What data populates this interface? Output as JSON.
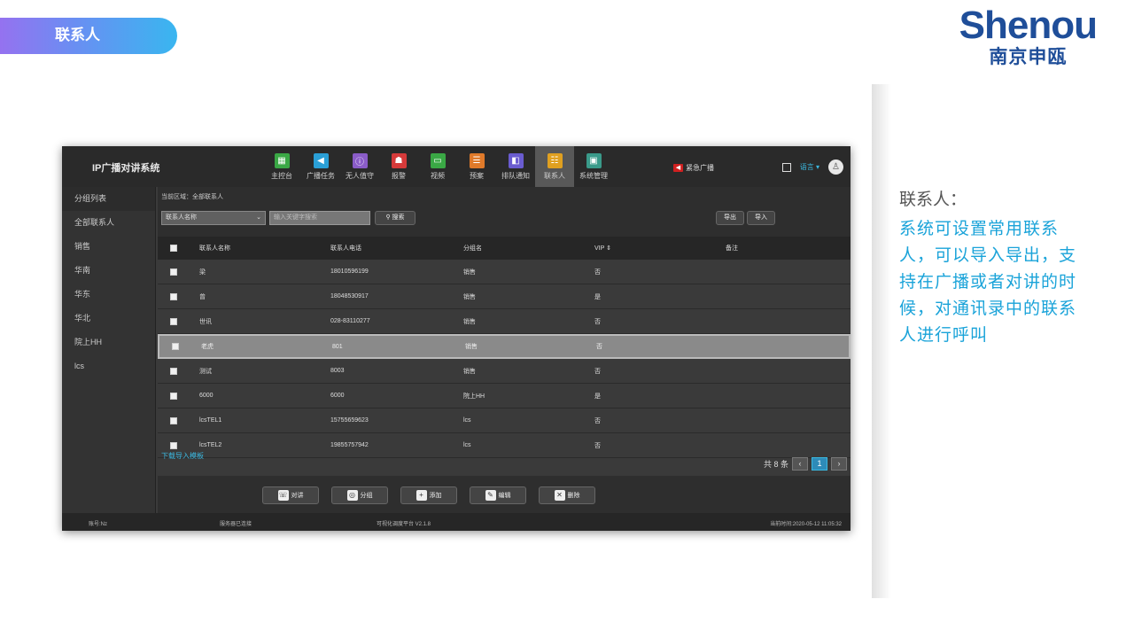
{
  "slide": {
    "tag_label": "联系人",
    "logo_en": "Shenou",
    "logo_cn": "南京申瓯",
    "desc_title": "联系人：",
    "desc_body": "系统可设置常用联系人，可以导入导出，支持在广播或者对讲的时候，对通讯录中的联系人进行呼叫"
  },
  "app": {
    "title": "IP广播对讲系统",
    "nav": [
      {
        "label": "主控台",
        "icon": "dashboard-icon",
        "color": "#3aa845",
        "glyph": "▦"
      },
      {
        "label": "广播任务",
        "icon": "broadcast-icon",
        "color": "#2a9fd6",
        "glyph": "◀"
      },
      {
        "label": "无人值守",
        "icon": "unattended-icon",
        "color": "#8a5cc7",
        "glyph": "ⓘ"
      },
      {
        "label": "报警",
        "icon": "alarm-icon",
        "color": "#d63a3a",
        "glyph": "☗"
      },
      {
        "label": "视频",
        "icon": "video-icon",
        "color": "#3aa845",
        "glyph": "▭"
      },
      {
        "label": "预案",
        "icon": "plan-icon",
        "color": "#e07a2a",
        "glyph": "☰"
      },
      {
        "label": "排队通知",
        "icon": "queue-icon",
        "color": "#6a5cd0",
        "glyph": "◧"
      },
      {
        "label": "联系人",
        "icon": "contacts-icon",
        "color": "#e0a020",
        "glyph": "☷"
      },
      {
        "label": "系统管理",
        "icon": "system-icon",
        "color": "#3a9a8a",
        "glyph": "▣"
      }
    ],
    "emergency_label": "紧急广播",
    "language_label": "语言 ▾",
    "sidebar": [
      "分组列表",
      "全部联系人",
      "销售",
      "华南",
      "华东",
      "华北",
      "院上HH",
      "lcs"
    ],
    "breadcrumb": "当前区域：全部联系人",
    "filter": {
      "select_value": "联系人名称",
      "search_placeholder": "输入关键字搜索",
      "search_label": "搜索",
      "export_label": "导出",
      "import_label": "导入"
    },
    "table": {
      "headers": [
        "联系人名称",
        "联系人电话",
        "分组名",
        "VIP ⇕",
        "备注"
      ],
      "rows": [
        [
          "梁",
          "18010596199",
          "销售",
          "否",
          ""
        ],
        [
          "曾",
          "18048530917",
          "销售",
          "是",
          ""
        ],
        [
          "世讯",
          "028-83110277",
          "销售",
          "否",
          ""
        ],
        [
          "老虎",
          "801",
          "销售",
          "否",
          ""
        ],
        [
          "测试",
          "8003",
          "销售",
          "否",
          ""
        ],
        [
          "6000",
          "6000",
          "院上HH",
          "是",
          ""
        ],
        [
          "lcsTEL1",
          "15755659623",
          "lcs",
          "否",
          ""
        ],
        [
          "lcsTEL2",
          "19855757942",
          "lcs",
          "否",
          ""
        ]
      ],
      "highlight_index": 3
    },
    "download_template": "下载导入模板",
    "pager": {
      "total": "共 8 条",
      "prev": "‹",
      "current": "1",
      "next": "›"
    },
    "actions": [
      {
        "label": "对讲",
        "icon": "intercom-icon",
        "glyph": "☏"
      },
      {
        "label": "分组",
        "icon": "group-icon",
        "glyph": "◎"
      },
      {
        "label": "添加",
        "icon": "add-icon",
        "glyph": "+"
      },
      {
        "label": "编辑",
        "icon": "edit-icon",
        "glyph": "✎"
      },
      {
        "label": "删除",
        "icon": "delete-icon",
        "glyph": "✕"
      }
    ],
    "footer": {
      "account": "账号:Nz",
      "server": "服务器已连接",
      "platform": "可视化调度平台 V2.1.8",
      "time": "当前时间:2020-05-12 11:05:32"
    }
  }
}
